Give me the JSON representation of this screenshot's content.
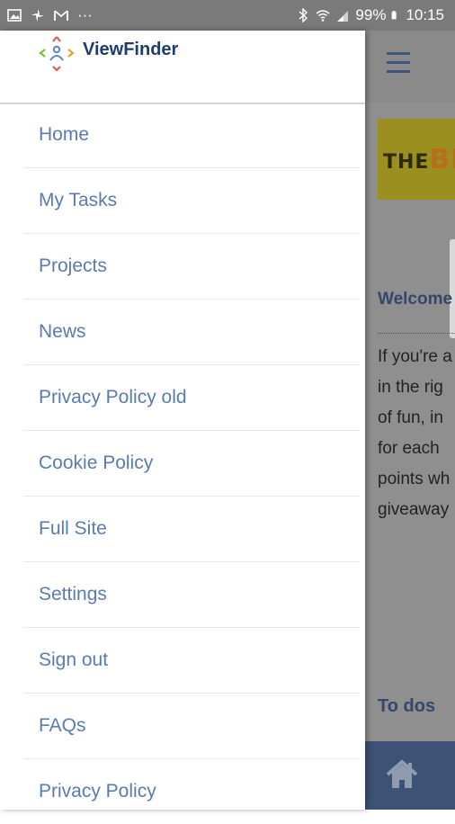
{
  "status_bar": {
    "battery": "99%",
    "time": "10:15",
    "icons": [
      "image-icon",
      "pinwheel-icon",
      "gmail-icon",
      "more-dots-icon",
      "bluetooth-icon",
      "wifi-icon",
      "signal-icon",
      "battery-icon"
    ]
  },
  "drawer": {
    "brand": "ViewFinder",
    "items": [
      {
        "label": "Home"
      },
      {
        "label": "My Tasks"
      },
      {
        "label": "Projects"
      },
      {
        "label": "News"
      },
      {
        "label": "Privacy Policy old"
      },
      {
        "label": "Cookie Policy"
      },
      {
        "label": "Full Site"
      },
      {
        "label": "Settings"
      },
      {
        "label": "Sign out"
      },
      {
        "label": "FAQs"
      },
      {
        "label": "Privacy Policy"
      }
    ]
  },
  "background": {
    "banner_text_small": "THE",
    "banner_text_big": "BE",
    "welcome": "Welcome",
    "paragraph": [
      "If you're a",
      "in the rig",
      "of fun, in",
      "for each",
      "points wh",
      "giveaway"
    ],
    "todos": "To dos"
  },
  "colors": {
    "menu_text": "#5a7bb0",
    "brand": "#1f3c6e",
    "bottom_bar": "#3d5275",
    "status_bar": "#7a7a7a"
  }
}
